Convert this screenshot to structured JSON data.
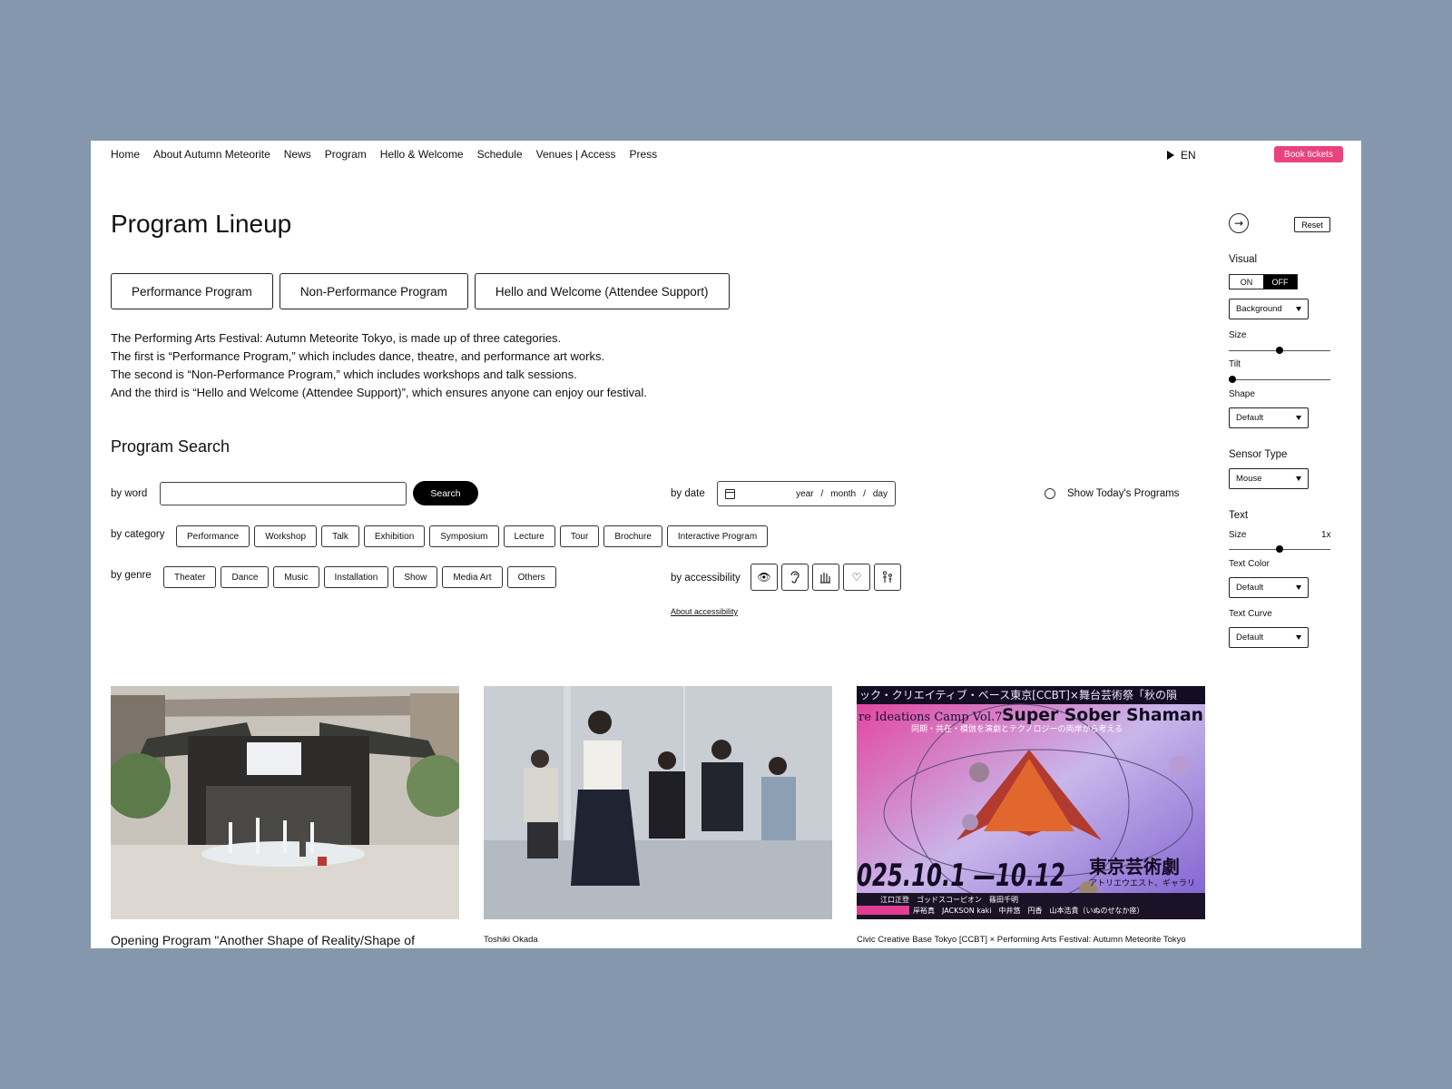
{
  "nav": {
    "items": [
      "Home",
      "About Autumn Meteorite",
      "News",
      "Program",
      "Hello & Welcome",
      "Schedule",
      "Venues | Access",
      "Press"
    ],
    "lang": "EN",
    "book_label": "Book tickets"
  },
  "page_title": "Program Lineup",
  "category_tabs": [
    "Performance Program",
    "Non-Performance Program",
    "Hello and Welcome (Attendee Support)"
  ],
  "intro": [
    "The Performing Arts Festival: Autumn Meteorite Tokyo, is made up of three categories.",
    "The first is “Performance Program,” which includes dance, theatre, and performance art works.",
    "The second is “Non-Performance Program,” which includes workshops and talk sessions.",
    "And the third is “Hello and Welcome (Attendee Support)”, which ensures anyone can enjoy our festival."
  ],
  "search": {
    "title": "Program Search",
    "by_word": "by word",
    "word_value": "",
    "search_label": "Search",
    "by_date": "by date",
    "date_year": "year",
    "date_month": "month",
    "date_day": "day",
    "date_sep": "/",
    "today_label": "Show Today's Programs",
    "by_category": "by category",
    "categories": [
      "Performance",
      "Workshop",
      "Talk",
      "Exhibition",
      "Symposium",
      "Lecture",
      "Tour",
      "Brochure",
      "Interactive Program"
    ],
    "by_genre": "by genre",
    "genres": [
      "Theater",
      "Dance",
      "Music",
      "Installation",
      "Show",
      "Media Art",
      "Others"
    ],
    "by_accessibility": "by accessibility",
    "accessibility_icons": [
      "eye-icon",
      "ear-icon",
      "sign-language-icon",
      "heart-icon",
      "family-icon"
    ],
    "about_accessibility": "About accessibility"
  },
  "panel": {
    "reset_label": "Reset",
    "visual_label": "Visual",
    "toggle_on": "ON",
    "toggle_off": "OFF",
    "toggle_state": "OFF",
    "background_select": "Background",
    "size_label": "Size",
    "size_level": 0.5,
    "tilt_label": "Tilt",
    "tilt_level": 0.0,
    "shape_label": "Shape",
    "shape_select": "Default",
    "sensor_label": "Sensor Type",
    "sensor_select": "Mouse",
    "text_label": "Text",
    "text_size_label": "Size",
    "text_size_value": "1x",
    "text_size_level": 0.5,
    "text_color_label": "Text Color",
    "text_color_select": "Default",
    "text_curve_label": "Text Curve",
    "text_curve_select": "Default"
  },
  "cards": [
    {
      "caption": "Opening Program \"Another Shape of Reality/Shape of"
    },
    {
      "caption": "Toshiki Okada"
    },
    {
      "caption": "Civic Creative Base Tokyo [CCBT] × Performing Arts Festival: Autumn Meteorite Tokyo",
      "poster": {
        "top_line": "ック・クリエイティブ・ベース東京[CCBT]×舞台芸術祭「秋の隕",
        "camp": "re Ideations Camp Vol.7",
        "headline": "Super Sober Shaman",
        "subline": "同期・共在・模倣を演劇とテクノロジーの両岸から考える",
        "dates": "025.10.1 —10.12",
        "venue": "東京芸術劇",
        "venue_sub": "アトリエウエスト、ギャラリ",
        "names_1": "江口正登　ゴッドスコーピオン　篠田千明",
        "names_2": "岸裕真　JACKSON kaki　中井悠　円香　山本浩貴（いぬのせなか座）"
      }
    }
  ],
  "colors": {
    "background": "#8497ad",
    "accent": "#e9427e"
  }
}
